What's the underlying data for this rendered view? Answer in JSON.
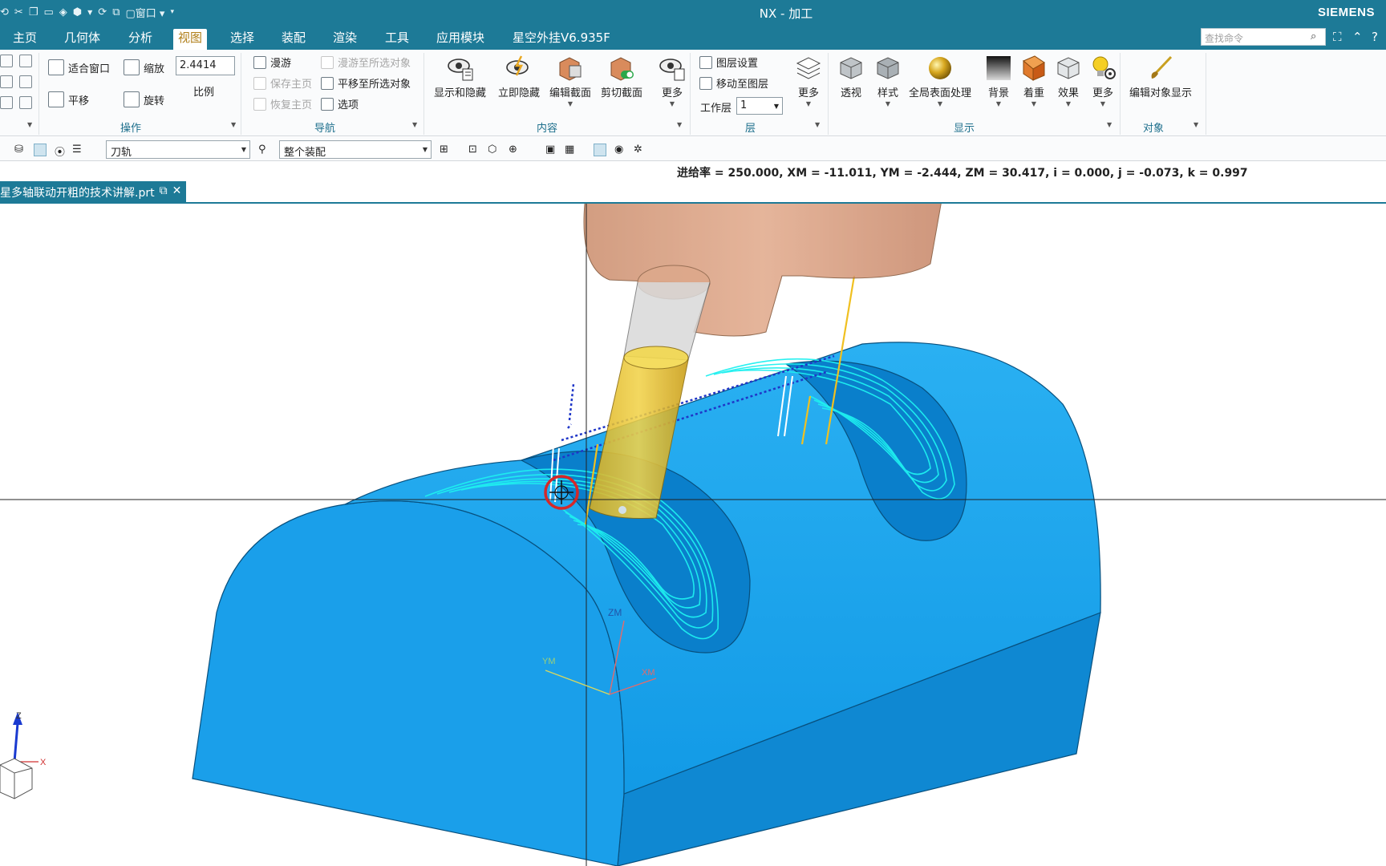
{
  "titlebar": {
    "window_menu": "窗口",
    "title": "NX - 加工",
    "brand": "SIEMENS"
  },
  "menu": {
    "tabs": [
      "主页",
      "几何体",
      "分析",
      "视图",
      "选择",
      "装配",
      "渲染",
      "工具",
      "应用模块",
      "星空外挂V6.935F"
    ],
    "active": "视图",
    "search_placeholder": "查找命令"
  },
  "ribbon": {
    "operate": {
      "label": "操作",
      "fit": "适合窗口",
      "zoom": "缩放",
      "zoom_value": "2.4414",
      "scale": "比例",
      "pan": "平移",
      "rotate": "旋转"
    },
    "navigate": {
      "label": "导航",
      "walk": "漫游",
      "walk_to_selected": "漫游至所选对象",
      "save_home": "保存主页",
      "pan_to_selected": "平移至所选对象",
      "restore_home": "恢复主页",
      "options": "选项"
    },
    "content": {
      "label": "内容",
      "show_hide": "显示和隐藏",
      "hide_now": "立即隐藏",
      "edit_section": "编辑截面",
      "clip_section": "剪切截面",
      "more": "更多"
    },
    "layer": {
      "label": "层",
      "layer_settings": "图层设置",
      "move_to_layer": "移动至图层",
      "work_layer": "工作层",
      "work_layer_value": "1",
      "more": "更多"
    },
    "display": {
      "label": "显示",
      "perspective": "透视",
      "style": "样式",
      "global_finish": "全局表面处理",
      "background": "背景",
      "coloring": "着重",
      "effects": "效果",
      "more": "更多"
    },
    "object": {
      "label": "对象",
      "edit_display": "编辑对象显示"
    }
  },
  "selbar": {
    "filter_type": "刀轨",
    "scope": "整个装配"
  },
  "status": {
    "readout": "进给率 = 250.000, XM = -11.011, YM = -2.444, ZM = 30.417, i = 0.000, j = -0.073, k = 0.997"
  },
  "document": {
    "tab_name": "星多轴联动开粗的技术讲解.prt"
  },
  "viewport": {
    "mcs_labels": {
      "zm": "ZM",
      "ym": "YM",
      "xm": "XM"
    },
    "wcs_labels": {
      "z": "Z",
      "x": "X"
    }
  },
  "colors": {
    "chrome": "#1d7a97",
    "part": "#1fa4ea",
    "toolpath": "#1ef0f0",
    "tool_holder": "#d8926f",
    "tool": "#e8c232"
  }
}
